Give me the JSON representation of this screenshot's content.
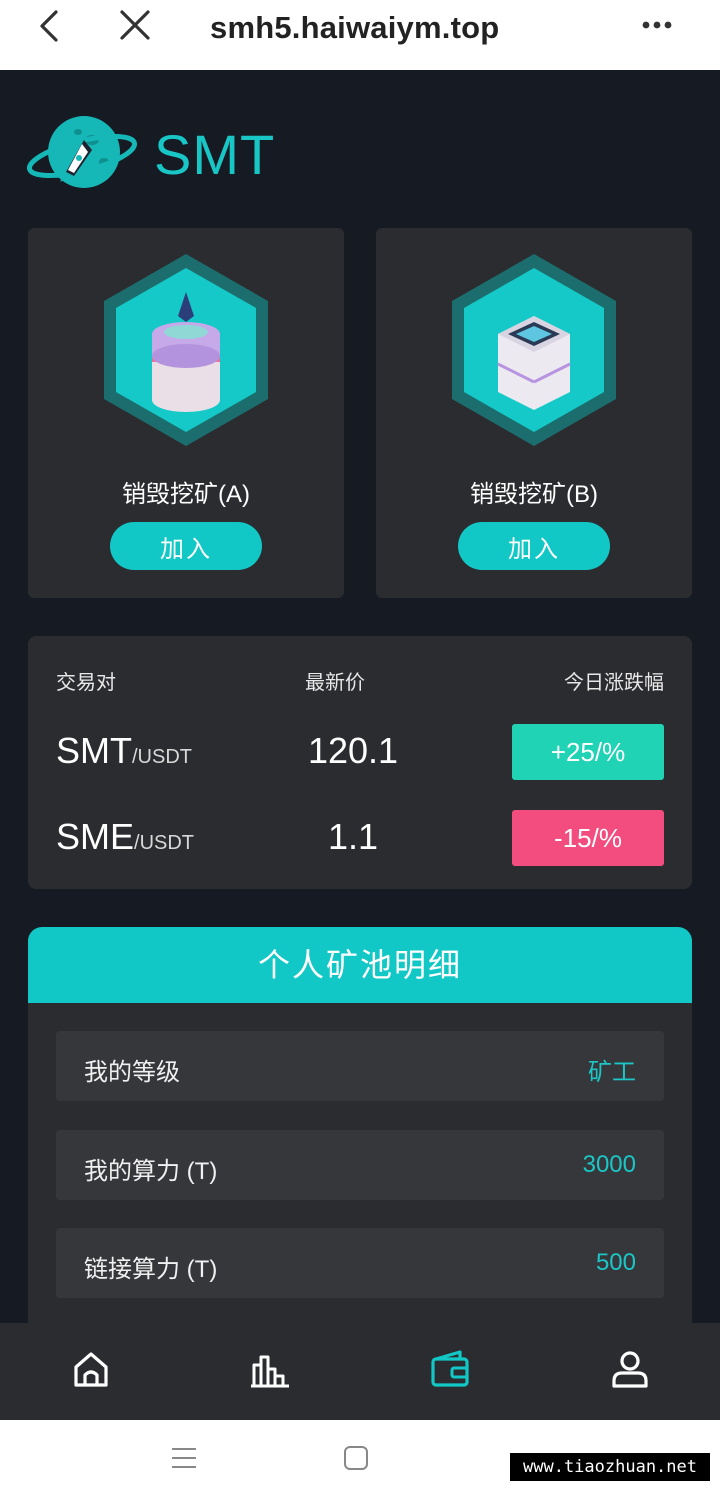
{
  "browser": {
    "url": "smh5.haiwaiym.top",
    "back_icon": "chevron-left-icon",
    "close_icon": "close-icon",
    "more_icon": "more-dots-icon"
  },
  "brand": {
    "name": "SMT",
    "color": "#19c6c6"
  },
  "mining_cards": [
    {
      "title": "销毁挖矿(A)",
      "join_label": "加入",
      "icon": "coin-stack-icon"
    },
    {
      "title": "销毁挖矿(B)",
      "join_label": "加入",
      "icon": "server-box-icon"
    }
  ],
  "market": {
    "headers": [
      "交易对",
      "最新价",
      "今日涨跌幅"
    ],
    "rows": [
      {
        "base": "SMT",
        "quote": "/USDT",
        "price": "120.1",
        "change": "+25/%",
        "trend": "up"
      },
      {
        "base": "SME",
        "quote": "/USDT",
        "price": "1.1",
        "change": "-15/%",
        "trend": "down"
      }
    ],
    "up_color": "#1fd3b4",
    "down_color": "#f34d7f"
  },
  "pool": {
    "title": "个人矿池明细",
    "rows": [
      {
        "label": "我的等级",
        "value": "矿工"
      },
      {
        "label": "我的算力 (T)",
        "value": "3000"
      },
      {
        "label": "链接算力 (T)",
        "value": "500"
      }
    ]
  },
  "tabbar": {
    "items": [
      "home-icon",
      "chart-icon",
      "wallet-icon",
      "user-icon"
    ],
    "active_color": "#12c8c6"
  },
  "watermark": "www.tiaozhuan.net"
}
